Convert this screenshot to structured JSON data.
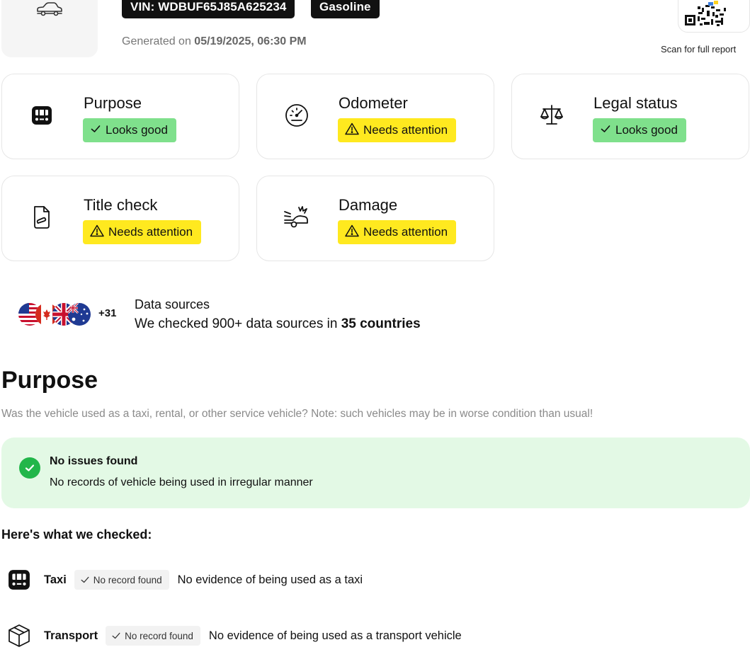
{
  "header": {
    "vin_chip": "VIN: WDBUF65J85A625234",
    "fuel_chip": "Gasoline",
    "generated_prefix": "Generated on ",
    "generated_date": "05/19/2025, 06:30 PM",
    "scan_text": "Scan for full report"
  },
  "cards": [
    {
      "title": "Purpose",
      "status": "Looks good",
      "state": "good",
      "icon": "taxi-icon"
    },
    {
      "title": "Odometer",
      "status": "Needs attention",
      "state": "warn",
      "icon": "speedometer-icon"
    },
    {
      "title": "Legal status",
      "status": "Looks good",
      "state": "good",
      "icon": "scales-icon"
    },
    {
      "title": "Title check",
      "status": "Needs attention",
      "state": "warn",
      "icon": "document-icon"
    },
    {
      "title": "Damage",
      "status": "Needs attention",
      "state": "warn",
      "icon": "crash-icon"
    }
  ],
  "data_sources": {
    "more_count": "+31",
    "title": "Data sources",
    "text_prefix": "We checked 900+ data sources in ",
    "text_bold": "35 countries",
    "flags": [
      "us-flag-icon",
      "ca-flag-icon",
      "uk-flag-icon",
      "au-flag-icon"
    ]
  },
  "purpose": {
    "title": "Purpose",
    "description": "Was the vehicle used as a taxi, rental, or other service vehicle? Note: such vehicles may be in worse condition than usual!",
    "result_title": "No issues found",
    "result_text": "No records of vehicle being used in irregular manner",
    "checked_title": "Here's what we checked:",
    "checks": [
      {
        "label": "Taxi",
        "tag": "No record found",
        "description": "No evidence of being used as a taxi",
        "icon": "taxi-icon"
      },
      {
        "label": "Transport",
        "tag": "No record found",
        "description": "No evidence of being used as a transport vehicle",
        "icon": "box-icon"
      }
    ]
  },
  "colors": {
    "good": "#7fe08c",
    "warn": "#ffe91f",
    "success_bg": "#e3f9e5",
    "success_icon": "#22b64a"
  }
}
